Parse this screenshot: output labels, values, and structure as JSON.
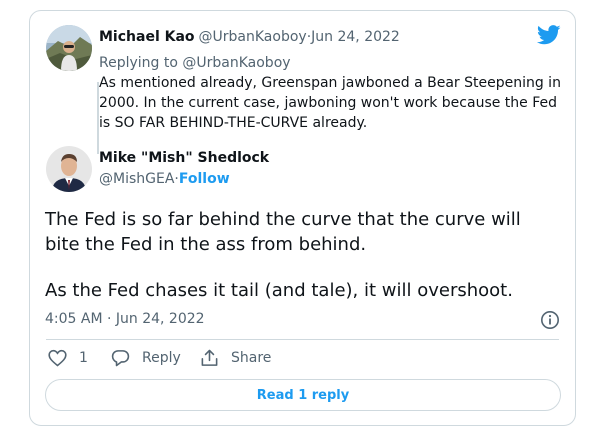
{
  "parent_tweet": {
    "author_name": "Michael Kao",
    "handle": "@UrbanKaoboy",
    "separator": " · ",
    "date": "Jun 24, 2022",
    "replying_prefix": "Replying to ",
    "replying_to": "@UrbanKaoboy",
    "text": "As mentioned already, Greenspan jawboned a Bear Steepening in 2000. In the current case, jawboning won't work because the Fed is SO FAR BEHIND-THE-CURVE already."
  },
  "main_tweet": {
    "author_name": "Mike \"Mish\" Shedlock",
    "handle": "@MishGEA",
    "separator": " · ",
    "follow_label": "Follow",
    "paragraph1": "The Fed is so far behind the curve that the curve will bite the Fed in the ass from behind.",
    "paragraph2": "As the Fed chases it tail (and tale), it will overshoot.",
    "timestamp": "4:05 AM · Jun 24, 2022"
  },
  "actions": {
    "like_count": "1",
    "reply_label": "Reply",
    "share_label": "Share"
  },
  "read_replies_label": "Read 1 reply",
  "icons": {
    "brand": "twitter-bird-icon",
    "info": "info-icon",
    "like": "heart-icon",
    "reply": "speech-bubble-icon",
    "share": "share-icon"
  },
  "colors": {
    "brand_blue": "#1d9bf0",
    "text": "#0f1419",
    "muted": "#536471",
    "border": "#cfd9de"
  }
}
